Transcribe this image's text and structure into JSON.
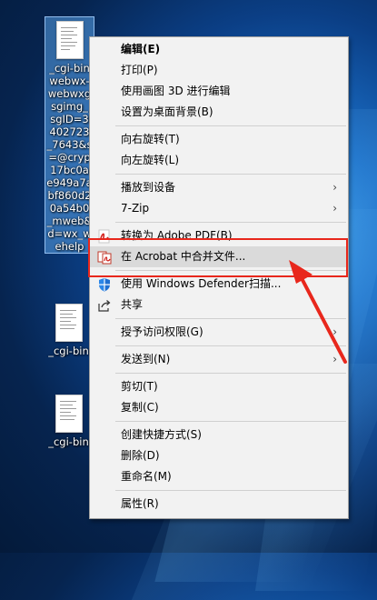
{
  "desktop": {
    "icons": [
      {
        "label_lines": [
          "_cgi-bin",
          "webwx-",
          "webwxg",
          "sgimg_",
          "sgID=3",
          "402723",
          "_7643&s",
          "=@cryp",
          "17bc0a",
          "e949a7a",
          "bf860d2",
          "0a54b0",
          "_mweb&",
          "d=wx_w",
          "ehelp"
        ],
        "selected": true
      },
      {
        "label_lines": [
          "_cgi-bin"
        ],
        "selected": false
      },
      {
        "label_lines": [
          "_cgi-bin"
        ],
        "selected": false
      }
    ]
  },
  "context_menu": {
    "items": [
      {
        "label": "编辑(E)",
        "bold": true
      },
      {
        "label": "打印(P)"
      },
      {
        "label": "使用画图 3D 进行编辑"
      },
      {
        "label": "设置为桌面背景(B)"
      },
      {
        "separator": true
      },
      {
        "label": "向右旋转(T)"
      },
      {
        "label": "向左旋转(L)"
      },
      {
        "separator": true
      },
      {
        "label": "播放到设备",
        "submenu": true
      },
      {
        "label": "7-Zip",
        "submenu": true
      },
      {
        "separator": true
      },
      {
        "label": "转换为 Adobe PDF(B)",
        "icon": "adobe-pdf-icon"
      },
      {
        "label": "在 Acrobat 中合并文件...",
        "icon": "acrobat-combine-icon",
        "highlighted": true
      },
      {
        "separator": true
      },
      {
        "label": "使用 Windows Defender扫描...",
        "icon": "windows-defender-icon"
      },
      {
        "label": "共享",
        "icon": "share-icon"
      },
      {
        "separator": true
      },
      {
        "label": "授予访问权限(G)",
        "submenu": true
      },
      {
        "separator": true
      },
      {
        "label": "发送到(N)",
        "submenu": true
      },
      {
        "separator": true
      },
      {
        "label": "剪切(T)"
      },
      {
        "label": "复制(C)"
      },
      {
        "separator": true
      },
      {
        "label": "创建快捷方式(S)"
      },
      {
        "label": "删除(D)"
      },
      {
        "label": "重命名(M)"
      },
      {
        "separator": true
      },
      {
        "label": "属性(R)"
      }
    ],
    "submenu_arrow": "›"
  },
  "annotation": {
    "color": "#e8271c"
  },
  "colors": {
    "menu_bg": "#f2f2f2",
    "highlight": "#dadada"
  }
}
